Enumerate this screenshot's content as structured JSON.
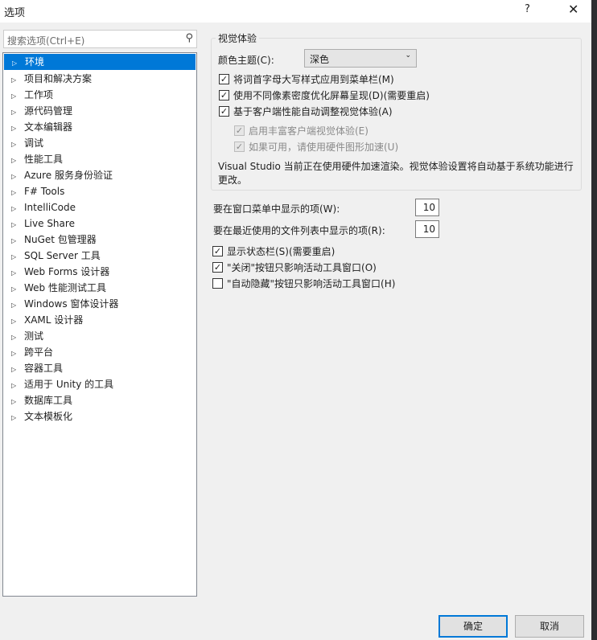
{
  "window": {
    "title": "选项",
    "help": "?",
    "close": "✕"
  },
  "search": {
    "placeholder": "搜索选项(Ctrl+E)"
  },
  "tree": [
    "环境",
    "项目和解决方案",
    "工作项",
    "源代码管理",
    "文本编辑器",
    "调试",
    "性能工具",
    "Azure 服务身份验证",
    "F# Tools",
    "IntelliCode",
    "Live Share",
    "NuGet 包管理器",
    "SQL Server 工具",
    "Web Forms 设计器",
    "Web 性能测试工具",
    "Windows 窗体设计器",
    "XAML 设计器",
    "测试",
    "跨平台",
    "容器工具",
    "适用于 Unity 的工具",
    "数据库工具",
    "文本模板化"
  ],
  "visual": {
    "group": "视觉体验",
    "theme_label": "颜色主题(C):",
    "theme_value": "深色",
    "options": [
      {
        "label": "将词首字母大写样式应用到菜单栏(M)",
        "checked": true
      },
      {
        "label": "使用不同像素密度优化屏幕呈现(D)(需要重启)",
        "checked": true
      },
      {
        "label": "基于客户端性能自动调整视觉体验(A)",
        "checked": true
      },
      {
        "label": "启用丰富客户端视觉体验(E)",
        "checked": true,
        "disabled": true
      },
      {
        "label": "如果可用，请使用硬件图形加速(U)",
        "checked": true,
        "disabled": true
      }
    ],
    "note": "Visual Studio 当前正在使用硬件加速渲染。视觉体验设置将自动基于系统功能进行更改。"
  },
  "window_menu": {
    "label": "要在窗口菜单中显示的项(W):",
    "value": "10"
  },
  "recent": {
    "label": "要在最近使用的文件列表中显示的项(R):",
    "value": "10"
  },
  "misc": [
    {
      "label": "显示状态栏(S)(需要重启)",
      "checked": true
    },
    {
      "label": "\"关闭\"按钮只影响活动工具窗口(O)",
      "checked": true
    },
    {
      "label": "\"自动隐藏\"按钮只影响活动工具窗口(H)",
      "checked": false
    }
  ],
  "buttons": {
    "ok": "确定",
    "cancel": "取消"
  }
}
